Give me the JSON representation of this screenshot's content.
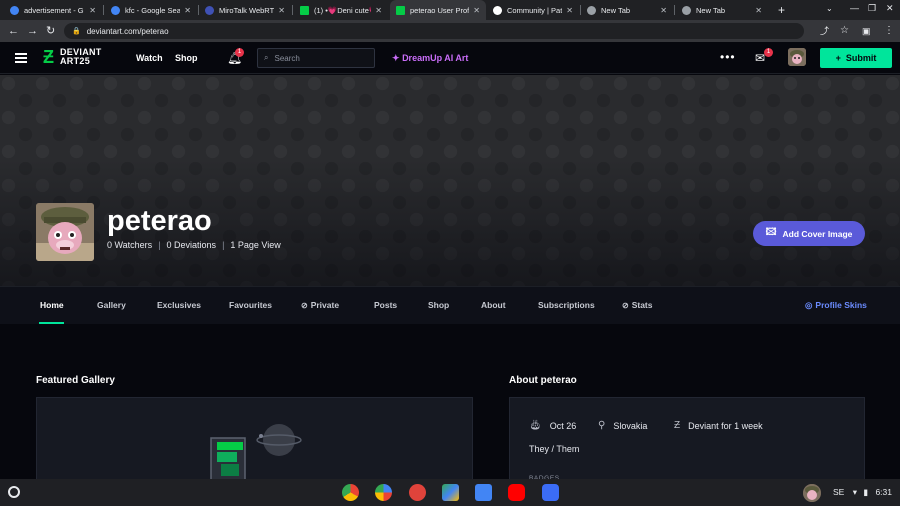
{
  "browser": {
    "tabs": [
      {
        "title": "advertisement - G",
        "favicon": "google-icon",
        "color": "#4285f4",
        "active": false
      },
      {
        "title": "kfc - Google Searc",
        "favicon": "google-icon",
        "color": "#4285f4",
        "active": false
      },
      {
        "title": "MiroTalk WebRTC",
        "favicon": "mirotalk-icon",
        "color": "#3f51b5",
        "active": false
      },
      {
        "title": "(1) •💗Deni cute💗",
        "favicon": "deviantart-icon",
        "color": "#05cc47",
        "active": false
      },
      {
        "title": "peterao User Profi",
        "favicon": "deviantart-icon",
        "color": "#05cc47",
        "active": true
      },
      {
        "title": "Community | Patr",
        "favicon": "patreon-icon",
        "color": "#ffffff",
        "active": false
      },
      {
        "title": "New Tab",
        "favicon": "chrome-icon",
        "color": "#9aa0a6",
        "active": false
      },
      {
        "title": "New Tab",
        "favicon": "chrome-icon",
        "color": "#9aa0a6",
        "active": false
      }
    ],
    "new_tab_symbol": "+",
    "url": "deviantart.com/peterao"
  },
  "header": {
    "logo_line1": "DEVIANT",
    "logo_line2": "ART25",
    "watch": "Watch",
    "shop": "Shop",
    "notifications_count": "1",
    "search_placeholder": "Search",
    "dreamup": "DreamUp AI Art",
    "messages_count": "1",
    "submit": "Submit"
  },
  "profile": {
    "username": "peterao",
    "watchers": "0 Watchers",
    "deviations": "0 Deviations",
    "page_views": "1 Page View",
    "add_cover": "Add Cover Image"
  },
  "profile_nav": {
    "home": "Home",
    "gallery": "Gallery",
    "exclusives": "Exclusives",
    "favourites": "Favourites",
    "private": "Private",
    "posts": "Posts",
    "shop": "Shop",
    "about": "About",
    "subscriptions": "Subscriptions",
    "stats": "Stats",
    "skins": "Profile Skins"
  },
  "featured": {
    "title": "Featured Gallery"
  },
  "about": {
    "title": "About peterao",
    "birthday": "Oct 26",
    "location": "Slovakia",
    "membership": "Deviant for 1 week",
    "pronouns": "They / Them",
    "badges_label": "BADGES"
  },
  "taskbar": {
    "locale": "SE",
    "time": "6:31"
  },
  "colors": {
    "accent_green": "#00e59b",
    "dreamup_purple": "#c96df8",
    "cover_button": "#5a5ad9",
    "skins_blue": "#6b8cff"
  }
}
